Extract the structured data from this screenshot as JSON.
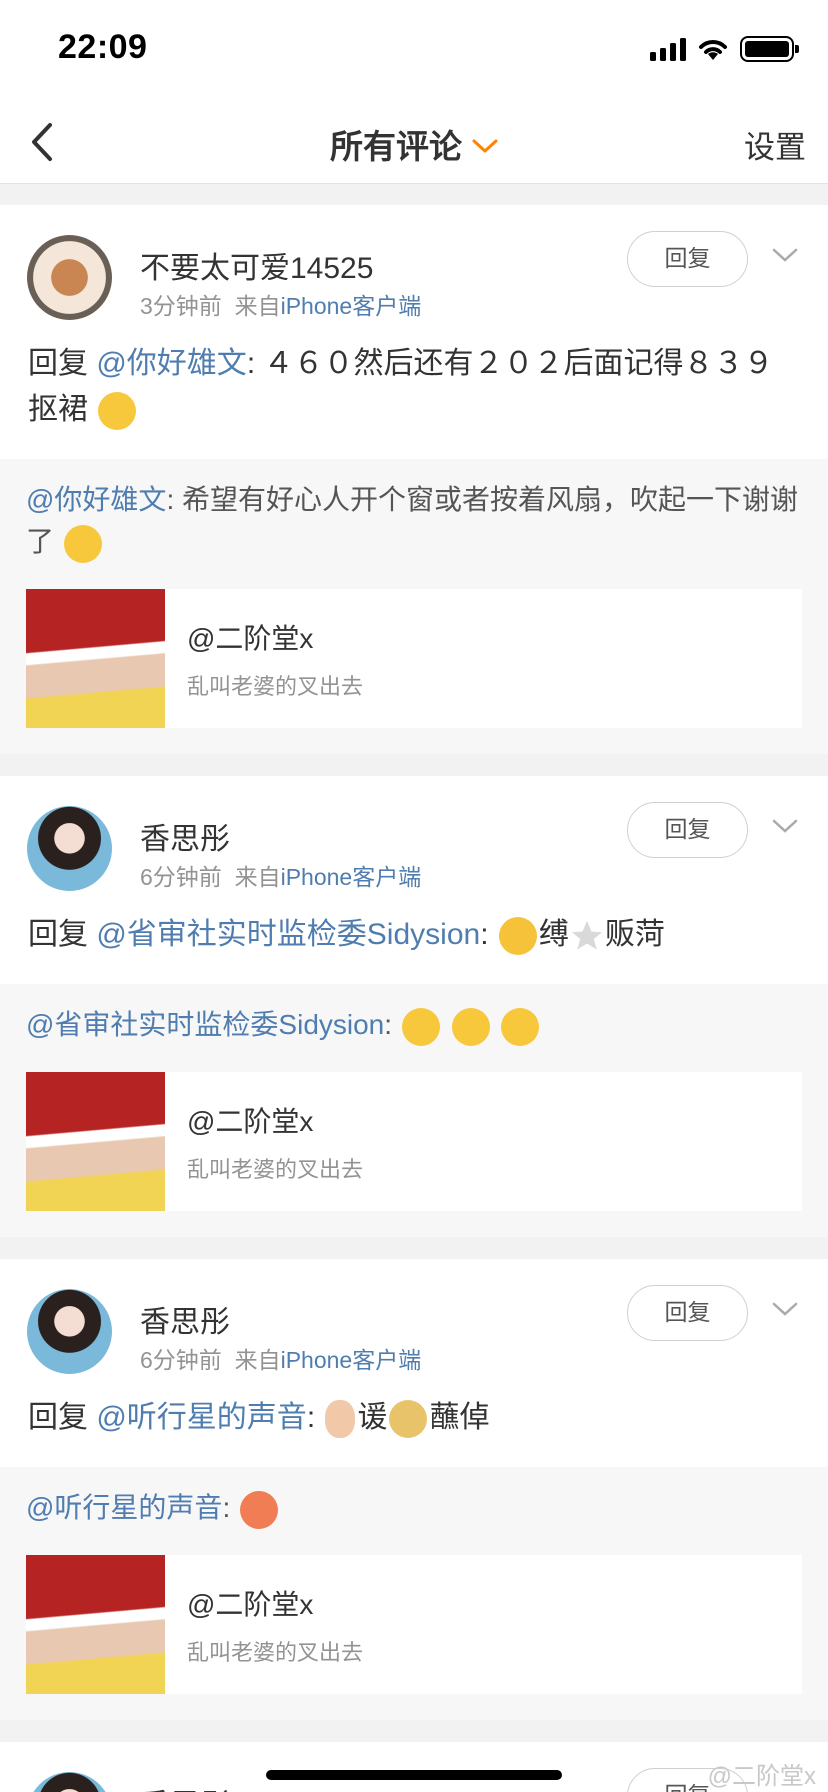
{
  "status_bar": {
    "time": "22:09"
  },
  "nav": {
    "title": "所有评论",
    "settings_label": "设置"
  },
  "comments": [
    {
      "username": "不要太可爱14525",
      "time": "3分钟前",
      "source_prefix": "来自",
      "source": "iPhone客户端",
      "reply_label": "回复",
      "reply_prefix": "回复",
      "mention": "@你好雄文",
      "body": ": ４６０然后还有２０２后面记得８３９抠裙",
      "quote_mention": "@你好雄文",
      "quote_body": ": 希望有好心人开个窗或者按着风扇，吹起一下谢谢了",
      "share_title": "@二阶堂x",
      "share_sub": "乱叫老婆的叉出去"
    },
    {
      "username": "香思彤",
      "time": "6分钟前",
      "source_prefix": "来自",
      "source": "iPhone客户端",
      "reply_label": "回复",
      "reply_prefix": "回复",
      "mention": "@省审社实时监检委Sidysion",
      "body_part1": ": ",
      "body_part2": "缚",
      "body_part3": "贩菏",
      "quote_mention": "@省审社实时监检委Sidysion",
      "quote_body": ": ",
      "share_title": "@二阶堂x",
      "share_sub": "乱叫老婆的叉出去"
    },
    {
      "username": "香思彤",
      "time": "6分钟前",
      "source_prefix": "来自",
      "source": "iPhone客户端",
      "reply_label": "回复",
      "reply_prefix": "回复",
      "mention": "@听行星的声音",
      "body_part1": ": ",
      "body_part2": "谖",
      "body_part3": "蘸倬",
      "quote_mention": "@听行星的声音",
      "quote_body": ": ",
      "share_title": "@二阶堂x",
      "share_sub": "乱叫老婆的叉出去"
    },
    {
      "username": "香思彤",
      "reply_label": "回复"
    }
  ],
  "watermark": "@二阶堂x",
  "icons": [
    "back-chevron-icon",
    "dropdown-chevron-icon",
    "more-chevron-icon",
    "signal-icon",
    "wifi-icon",
    "battery-icon"
  ],
  "colors": {
    "link": "#507daf",
    "accent": "#ff8200",
    "meta": "#939393"
  }
}
